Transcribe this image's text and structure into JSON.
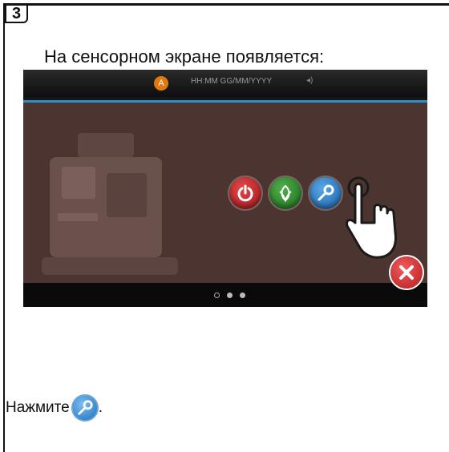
{
  "step": {
    "number": "3"
  },
  "instruction": {
    "text": "На сенсорном экране появляется:"
  },
  "screen": {
    "status_bar": {
      "indicator_letter": "A",
      "datetime": "HH:MM GG/MM/YYYY"
    },
    "buttons": [
      {
        "name": "power",
        "icon": "power-icon",
        "color": "#c0282b"
      },
      {
        "name": "eco",
        "icon": "leaf-icon",
        "color": "#2e8a2c"
      },
      {
        "name": "maintenance",
        "icon": "key-icon",
        "color": "#2a7fcc"
      }
    ],
    "close": {
      "icon": "close-icon",
      "color": "#d23131"
    },
    "pager": {
      "pages": 3,
      "active": 0
    }
  },
  "caption": {
    "prefix": "Нажмите",
    "suffix": "."
  },
  "colors": {
    "overlay": "#4c3531",
    "accent_border": "#2f8fc8"
  }
}
